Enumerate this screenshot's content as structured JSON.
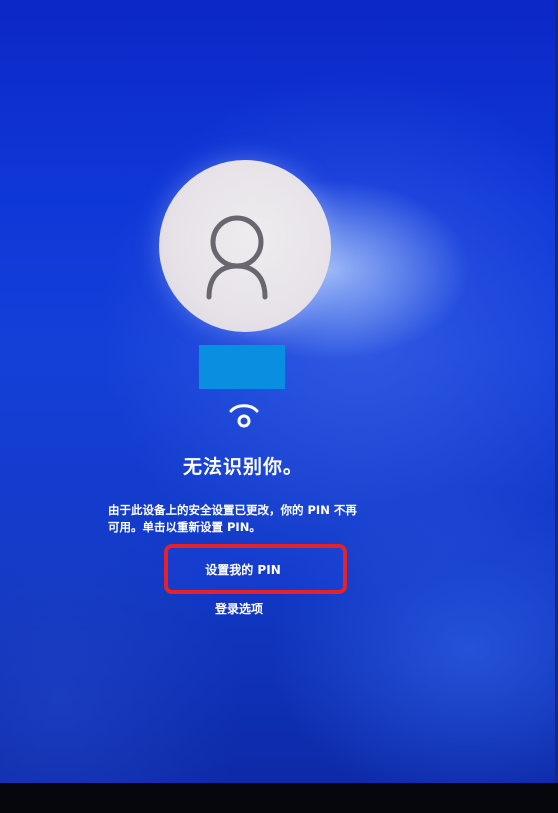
{
  "lock_screen": {
    "heading": "无法识别你。",
    "message_line1": "由于此设备上的安全设置已更改，你的 PIN 不再",
    "message_line2": "可用。单击以重新设置 PIN。",
    "set_pin_button": "设置我的 PIN",
    "signin_options_link": "登录选项"
  },
  "icons": {
    "avatar": "user-avatar-icon",
    "face_recognition": "windows-hello-face-icon"
  },
  "colors": {
    "background": "#1540d8",
    "highlight_border": "#e8202a",
    "username_block": "#0a8fe0",
    "text": "#ffffff"
  }
}
